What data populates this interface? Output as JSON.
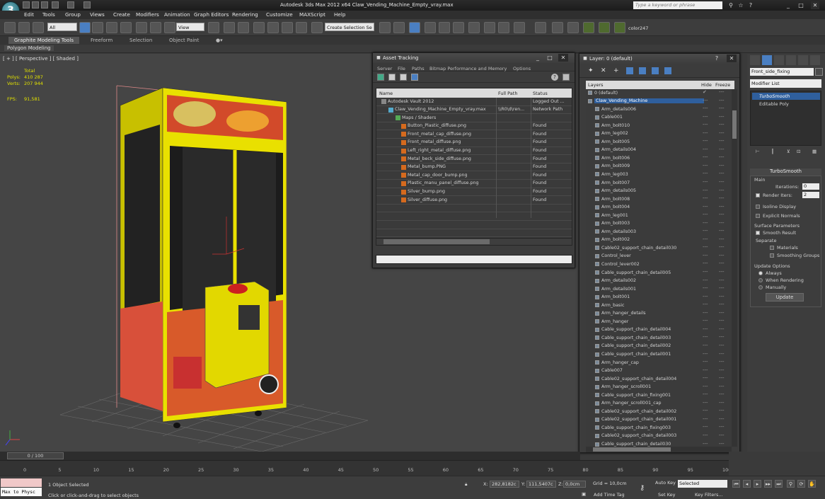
{
  "app": {
    "title": "Autodesk 3ds Max  2012 x64     Claw_Vending_Machine_Empty_vray.max",
    "logo": "3ds-max-logo",
    "search_placeholder": "Type a keyword or phrase"
  },
  "menu": [
    "Edit",
    "Tools",
    "Group",
    "Views",
    "Create",
    "Modifiers",
    "Animation",
    "Graph Editors",
    "Rendering",
    "Customize",
    "MAXScript",
    "Help"
  ],
  "toolbar": {
    "filter": "All",
    "refcoord": "View",
    "named_selection": "Create Selection Se",
    "color_label": "color247"
  },
  "ribbon": {
    "tabs": [
      "Graphite Modeling Tools",
      "Freeform",
      "Selection",
      "Object Paint"
    ],
    "active_tab": "Graphite Modeling Tools",
    "sub_tab": "Polygon Modeling"
  },
  "viewport": {
    "label": "[ + ] [ Perspective ] [ Shaded ]",
    "stats_header": "Total",
    "polys_label": "Polys:",
    "polys": "410 287",
    "verts_label": "Verts:",
    "verts": "207 944",
    "fps_label": "FPS:",
    "fps": "91,581"
  },
  "asset_tracking": {
    "title": "Asset Tracking",
    "menu": [
      "Server",
      "File",
      "Paths",
      "Bitmap Performance and Memory",
      "Options"
    ],
    "columns": [
      "Name",
      "Full Path",
      "Status"
    ],
    "rows": [
      {
        "name": "Autodesk Vault 2012",
        "path": "",
        "status": "Logged Out ...",
        "indent": 1
      },
      {
        "name": "Claw_Vending_Machine_Empty_vray.max",
        "path": "\\\\R0\\d\\ren...",
        "status": "Network Path",
        "indent": 2
      },
      {
        "name": "Maps / Shaders",
        "path": "",
        "status": "",
        "indent": 3
      },
      {
        "name": "Button_Plastic_diffuse.png",
        "path": "",
        "status": "Found",
        "indent": 4
      },
      {
        "name": "Front_metal_cap_diffuse.png",
        "path": "",
        "status": "Found",
        "indent": 4
      },
      {
        "name": "Front_metal_diffuse.png",
        "path": "",
        "status": "Found",
        "indent": 4
      },
      {
        "name": "Left_right_metal_diffuse.png",
        "path": "",
        "status": "Found",
        "indent": 4
      },
      {
        "name": "Metal_beck_side_diffuse.png",
        "path": "",
        "status": "Found",
        "indent": 4
      },
      {
        "name": "Metal_bump.PNG",
        "path": "",
        "status": "Found",
        "indent": 4
      },
      {
        "name": "Metal_cap_door_bump.png",
        "path": "",
        "status": "Found",
        "indent": 4
      },
      {
        "name": "Plastic_manu_panel_diffuse.png",
        "path": "",
        "status": "Found",
        "indent": 4
      },
      {
        "name": "Silver_bump.png",
        "path": "",
        "status": "Found",
        "indent": 4
      },
      {
        "name": "Silver_diffuse.png",
        "path": "",
        "status": "Found",
        "indent": 4
      }
    ]
  },
  "layers": {
    "title": "Layer: 0 (default)",
    "columns": [
      "Layers",
      "Hide",
      "Freeze"
    ],
    "items": [
      "0 (default)",
      "Claw_Vending_Machine",
      "Arm_details006",
      "Cable001",
      "Arm_bolt010",
      "Arm_leg002",
      "Arm_bolt005",
      "Arm_details004",
      "Arm_bolt006",
      "Arm_bolt009",
      "Arm_leg003",
      "Arm_bolt007",
      "Arm_details005",
      "Arm_bolt008",
      "Arm_bolt004",
      "Arm_leg001",
      "Arm_bolt003",
      "Arm_details003",
      "Arm_bolt002",
      "Cable02_support_chain_detail030",
      "Control_lever",
      "Control_lever002",
      "Cable_support_chain_detail005",
      "Arm_details002",
      "Arm_details001",
      "Arm_bolt001",
      "Arm_basic",
      "Arm_hanger_details",
      "Arm_hanger",
      "Cable_support_chain_detail004",
      "Cable_support_chain_detail003",
      "Cable_support_chain_detail002",
      "Cable_support_chain_detail001",
      "Arm_hanger_cap",
      "Cable007",
      "Cable02_support_chain_detail004",
      "Arm_hanger_scroll001",
      "Cable_support_chain_fixing001",
      "Arm_hanger_scroll001_cap",
      "Cable02_support_chain_detail002",
      "Cable02_support_chain_detail001",
      "Cable_support_chain_fixing003",
      "Cable02_support_chain_detail003",
      "Cable_support_chain_detail030"
    ],
    "selected_index": 1
  },
  "command_panel": {
    "object_name": "Front_side_fixing",
    "modifier_list": "Modifier List",
    "stack": [
      "TurboSmooth",
      "Editable Poly"
    ],
    "turbosmooth": {
      "title": "TurboSmooth",
      "main": "Main",
      "iterations_label": "Iterations:",
      "iterations": "0",
      "render_iters_label": "Render Iters:",
      "render_iters": "2",
      "isoline": "Isoline Display",
      "explicit": "Explicit Normals",
      "surface": "Surface Parameters",
      "smooth_result": "Smooth Result",
      "separate": "Separate",
      "materials": "Materials",
      "smoothing_groups": "Smoothing Groups",
      "update_options": "Update Options",
      "always": "Always",
      "when_rendering": "When Rendering",
      "manually": "Manually",
      "update_button": "Update"
    }
  },
  "timeline": {
    "frame": "0 / 100",
    "ticks": [
      "0",
      "5",
      "10",
      "15",
      "20",
      "25",
      "30",
      "35",
      "40",
      "45",
      "50",
      "55",
      "60",
      "65",
      "70",
      "75",
      "80",
      "85",
      "90",
      "95",
      "100"
    ]
  },
  "status": {
    "maxscript": "Max to Physc",
    "selected": "1 Object Selected",
    "prompt": "Click or click-and-drag to select objects",
    "x": "282,8182c",
    "y": "111,5407c",
    "z": "0,0cm",
    "grid": "Grid = 10,0cm",
    "add_time_tag": "Add Time Tag",
    "auto_key": "Auto Key",
    "set_key": "Set Key",
    "selected_drop": "Selected",
    "key_filters": "Key Filters..."
  },
  "colors": {
    "machine_yellow": "#e9e000",
    "selection_blue": "#2f5f9d",
    "viewport_bg": "#454545"
  }
}
